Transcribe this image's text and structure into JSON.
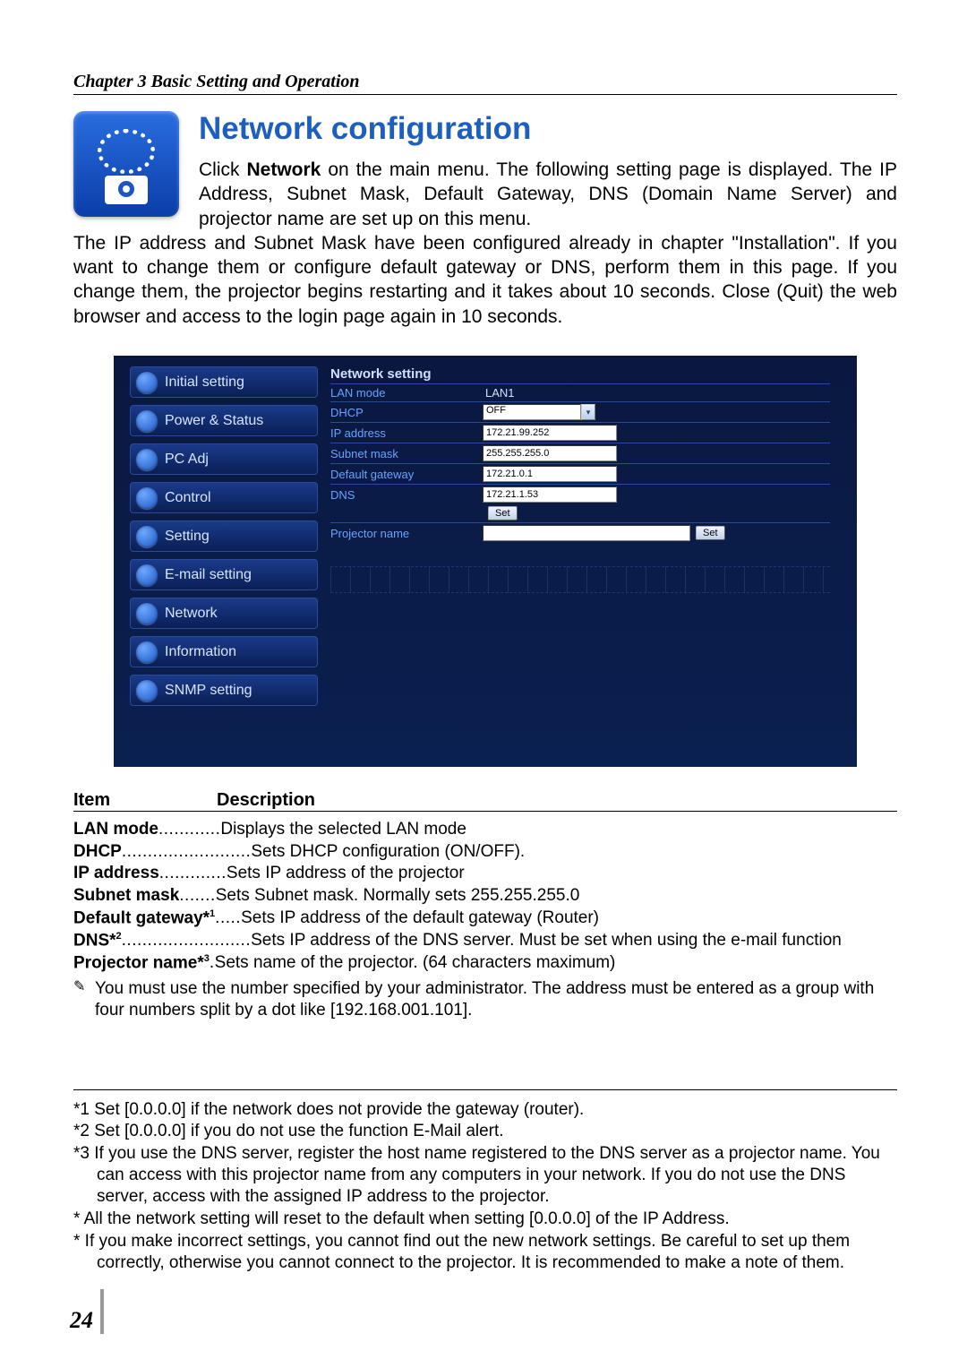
{
  "chapter": "Chapter 3 Basic Setting and Operation",
  "heading": "Network configuration",
  "intro_lead_prefix": "Click ",
  "intro_lead_bold": "Network",
  "intro_lead_rest": " on the main menu. The following setting page is displayed. The IP Address, Subnet Mask, Default Gateway, DNS (Domain Name Server) and projector name are set up on this menu.",
  "intro_body": "The IP address and Subnet Mask have been configured already in chapter \"Installation\". If you want to change them or configure default gateway or DNS, perform them in this page. If you change them, the projector begins restarting and it takes about 10 seconds. Close (Quit) the web browser and access to the login page again in 10 seconds.",
  "menu": {
    "items": [
      {
        "label": "Initial setting"
      },
      {
        "label": "Power & Status"
      },
      {
        "label": "PC Adj"
      },
      {
        "label": "Control"
      },
      {
        "label": "Setting"
      },
      {
        "label": "E-mail setting"
      },
      {
        "label": "Network"
      },
      {
        "label": "Information"
      },
      {
        "label": "SNMP setting"
      }
    ]
  },
  "form": {
    "title": "Network setting",
    "rows": {
      "lan_mode": {
        "label": "LAN mode",
        "value": "LAN1"
      },
      "dhcp": {
        "label": "DHCP",
        "value": "OFF"
      },
      "ip": {
        "label": "IP address",
        "value": "172.21.99.252"
      },
      "subnet": {
        "label": "Subnet mask",
        "value": "255.255.255.0"
      },
      "gateway": {
        "label": "Default gateway",
        "value": "172.21.0.1"
      },
      "dns": {
        "label": "DNS",
        "value": "172.21.1.53"
      },
      "projector": {
        "label": "Projector name",
        "value": ""
      }
    },
    "set_btn": "Set"
  },
  "desc": {
    "head_item": "Item",
    "head_desc": "Description",
    "rows": [
      {
        "term": "LAN mode",
        "dots": "............",
        "text": "Displays the selected LAN mode"
      },
      {
        "term": "DHCP",
        "dots": ".........................",
        "text": "Sets DHCP configuration (ON/OFF)."
      },
      {
        "term": "IP address",
        "dots": ".............",
        "text": "Sets IP address of the projector"
      },
      {
        "term": "Subnet mask",
        "dots": ".......",
        "text": "Sets Subnet mask. Normally sets 255.255.255.0"
      },
      {
        "term": "Default gateway*",
        "sup": "1",
        "dots": ".....",
        "text": "Sets IP address of the default gateway (Router)"
      },
      {
        "term": "DNS*",
        "sup": "2",
        "dots": ".........................",
        "text": "Sets IP address of the DNS server. Must be set when using the e-mail function"
      },
      {
        "term": "Projector name*",
        "sup": "3",
        "dots": ".",
        "text": "Sets name of the projector. (64 characters maximum)"
      }
    ],
    "note": "You must use the number specified by your administrator. The address must be entered as a group with four numbers split by a dot like [192.168.001.101]."
  },
  "footnotes": [
    "*1 Set [0.0.0.0] if the network does not provide the gateway (router).",
    "*2 Set [0.0.0.0] if you do not use the function E-Mail alert.",
    "*3 If you use the DNS server, register the host name registered to the DNS server as a projector name. You can access with this projector name from any computers in your network. If you do not use the DNS server, access with the assigned IP address to the projector.",
    "* All the network setting will reset to the default when setting [0.0.0.0] of the IP Address.",
    "* If you make incorrect settings, you cannot find out the new network settings. Be careful to set up them correctly, otherwise you cannot connect to the projector. It is recommended to make a note of them."
  ],
  "page_number": "24"
}
